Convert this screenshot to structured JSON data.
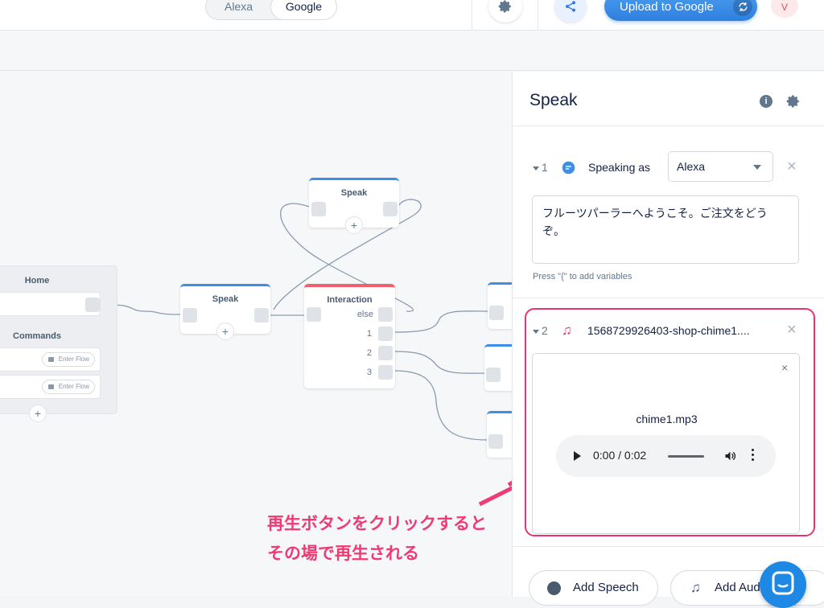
{
  "topbar": {
    "platform_alexa": "Alexa",
    "platform_google": "Google",
    "upload_label": "Upload to Google",
    "avatar_initial": "V"
  },
  "canvas": {
    "home": {
      "title": "Home",
      "commands_title": "Commands",
      "enter_flow_1": "Enter Flow",
      "enter_flow_2": "Enter Flow"
    },
    "speak_1_title": "Speak",
    "speak_2_title": "Speak",
    "interaction": {
      "title": "Interaction",
      "choices": [
        "else",
        "1",
        "2",
        "3"
      ]
    }
  },
  "panel": {
    "title": "Speak",
    "step1": {
      "number": "1",
      "label": "Speaking as",
      "voice": "Alexa",
      "text": "フルーツパーラーへようこそ。ご注文をどうぞ。",
      "hint": "Press \"{\" to add variables"
    },
    "step2": {
      "number": "2",
      "filename": "1568729926403-shop-chime1....",
      "audio_name": "chime1.mp3",
      "time": "0:00 / 0:02"
    },
    "add_speech": "Add Speech",
    "add_audio": "Add Audio"
  },
  "annotation": {
    "line1": "再生ボタンをクリックすると",
    "line2": "その場で再生される"
  },
  "colors": {
    "accent_blue": "#2f7fde",
    "highlight_pink": "#e8336d",
    "interaction_red": "#f0616d"
  }
}
